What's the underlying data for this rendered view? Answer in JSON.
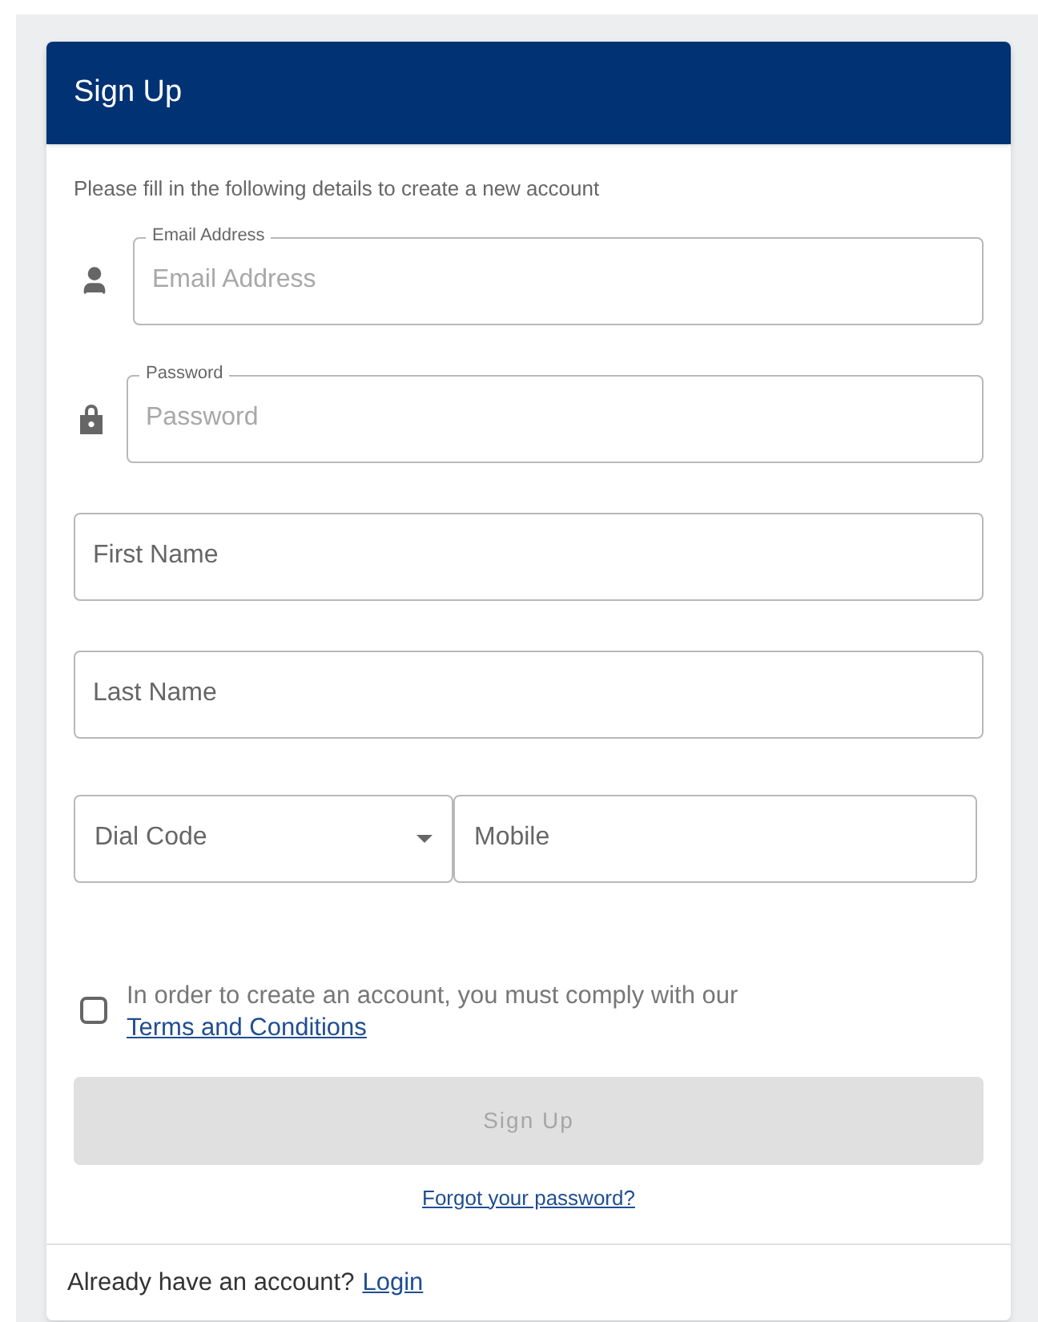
{
  "header": {
    "title": "Sign Up"
  },
  "intro": "Please fill in the following details to create a new account",
  "fields": [
    {
      "kind": "email",
      "label": "Email Address",
      "placeholder": "Email Address"
    },
    {
      "kind": "password",
      "label": "Password",
      "placeholder": "Password"
    },
    {
      "kind": "text",
      "placeholder": "First Name"
    },
    {
      "kind": "text",
      "placeholder": "Last Name"
    }
  ],
  "phone": {
    "dial_code": {
      "placeholder": "Dial Code"
    },
    "mobile": {
      "placeholder": "Mobile"
    }
  },
  "terms": {
    "checked": false,
    "text": "In order to create an account, you must comply with our",
    "link": "Terms and Conditions"
  },
  "submit": {
    "label": "Sign Up",
    "disabled": true
  },
  "forgot_link": "Forgot your password?",
  "footer": {
    "text": "Already have an account?",
    "link": "Login"
  }
}
